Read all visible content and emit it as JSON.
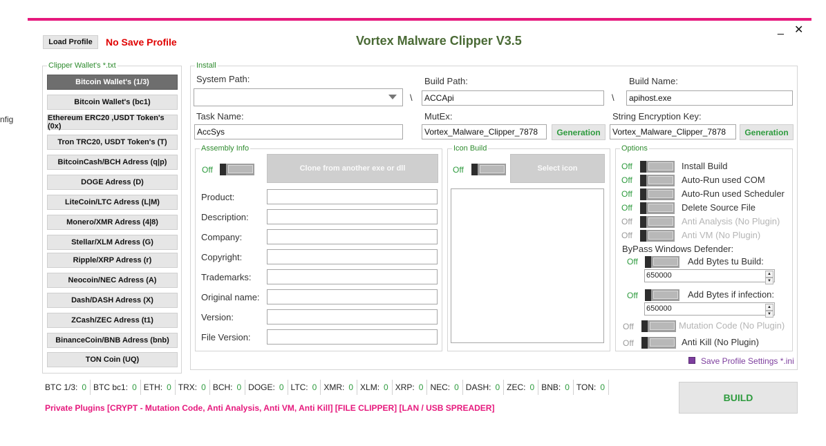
{
  "window": {
    "title": "Vortex Malware Clipper V3.5",
    "minimize": "_",
    "close": "✕",
    "side_fragment": "nfig"
  },
  "header": {
    "load_profile": "Load Profile",
    "no_save_profile": "No Save Profile"
  },
  "wallets": {
    "legend": "Clipper Wallet's *.txt",
    "items": [
      "Bitcoin Wallet's (1/3)",
      "Bitcoin Wallet's (bc1)",
      "Ethereum ERC20 ,USDT Token's (0x)",
      "Tron TRC20, USDT Token's (T)",
      "BitcoinCash/BCH Adress (q|p)",
      "DOGE Adress (D)",
      "LiteCoin/LTC Adress (L|M)",
      "Monero/XMR Adress (4|8)",
      "Stellar/XLM Adress (G)",
      "Ripple/XRP Adress (r)",
      "Neocoin/NEC Adress (A)",
      "Dash/DASH Adress (X)",
      "ZCash/ZEC Adress (t1)",
      "BinanceCoin/BNB Adress (bnb)",
      "TON Coin (UQ)"
    ]
  },
  "install": {
    "legend": "Install",
    "system_path_label": "System Path:",
    "system_path_value": "",
    "build_path_label": "Build Path:",
    "build_path_value": "ACCApi",
    "build_name_label": "Build Name:",
    "build_name_value": "apihost.exe",
    "separator": "\\",
    "task_name_label": "Task Name:",
    "task_name_value": "AccSys",
    "mutex_label": "MutEx:",
    "mutex_value": "Vortex_Malware_Clipper_7878",
    "mutex_generate": "Generation",
    "enc_key_label": "String Encryption Key:",
    "enc_key_value": "Vortex_Malware_Clipper_7878",
    "enc_key_generate": "Generation"
  },
  "assembly": {
    "legend": "Assembly Info",
    "toggle_state": "Off",
    "clone_button": "Clone from another exe or dll",
    "fields": [
      {
        "label": "Product:",
        "value": ""
      },
      {
        "label": "Description:",
        "value": ""
      },
      {
        "label": "Company:",
        "value": ""
      },
      {
        "label": "Copyright:",
        "value": ""
      },
      {
        "label": "Trademarks:",
        "value": ""
      },
      {
        "label": "Original name:",
        "value": ""
      },
      {
        "label": "Version:",
        "value": ""
      },
      {
        "label": "File Version:",
        "value": ""
      }
    ]
  },
  "icon_build": {
    "legend": "Icon Build",
    "toggle_state": "Off",
    "select_button": "Select icon"
  },
  "options": {
    "legend": "Options",
    "items": [
      {
        "state": "Off",
        "label": "Install Build",
        "enabled": true
      },
      {
        "state": "Off",
        "label": "Auto-Run used COM",
        "enabled": true
      },
      {
        "state": "Off",
        "label": "Auto-Run used Scheduler",
        "enabled": true
      },
      {
        "state": "Off",
        "label": "Delete Source File",
        "enabled": true
      },
      {
        "state": "Off",
        "label": "Anti Analysis (No Plugin)",
        "enabled": false
      },
      {
        "state": "Off",
        "label": "Anti VM (No Plugin)",
        "enabled": false
      }
    ],
    "bypass_label": "ByPass Windows Defender:",
    "add_bytes_build_state": "Off",
    "add_bytes_build_label": "Add Bytes tu Build:",
    "add_bytes_build_value": "650000",
    "add_bytes_infection_state": "Off",
    "add_bytes_infection_label": "Add Bytes if infection:",
    "add_bytes_infection_value": "650000",
    "mutation_state": "Off",
    "mutation_label": "Mutation Code (No Plugin)",
    "anti_kill_state": "Off",
    "anti_kill_label": "Anti Kill (No Plugin)"
  },
  "save_settings": {
    "checked": true,
    "label": "Save Profile Settings *.ini"
  },
  "stats": [
    {
      "key": "BTC 1/3:",
      "value": "0"
    },
    {
      "key": "BTC bc1:",
      "value": "0"
    },
    {
      "key": "ETH:",
      "value": "0"
    },
    {
      "key": "TRX:",
      "value": "0"
    },
    {
      "key": "BCH:",
      "value": "0"
    },
    {
      "key": "DOGE:",
      "value": "0"
    },
    {
      "key": "LTC:",
      "value": "0"
    },
    {
      "key": "XMR:",
      "value": "0"
    },
    {
      "key": "XLM:",
      "value": "0"
    },
    {
      "key": "XRP:",
      "value": "0"
    },
    {
      "key": "NEC:",
      "value": "0"
    },
    {
      "key": "DASH:",
      "value": "0"
    },
    {
      "key": "ZEC:",
      "value": "0"
    },
    {
      "key": "BNB:",
      "value": "0"
    },
    {
      "key": "TON:",
      "value": "0"
    }
  ],
  "footer": {
    "plugins_text": "Private Plugins [CRYPT - Mutation Code, Anti Analysis, Anti VM, Anti Kill] [FILE CLIPPER] [LAN / USB SPREADER]",
    "build_button": "BUILD"
  },
  "colors": {
    "accent_pink": "#e6197d",
    "title_green": "#4a6a35",
    "status_green": "#2e9b3e",
    "warning_red": "#e00000",
    "checkbox_purple": "#7d3e9e"
  }
}
